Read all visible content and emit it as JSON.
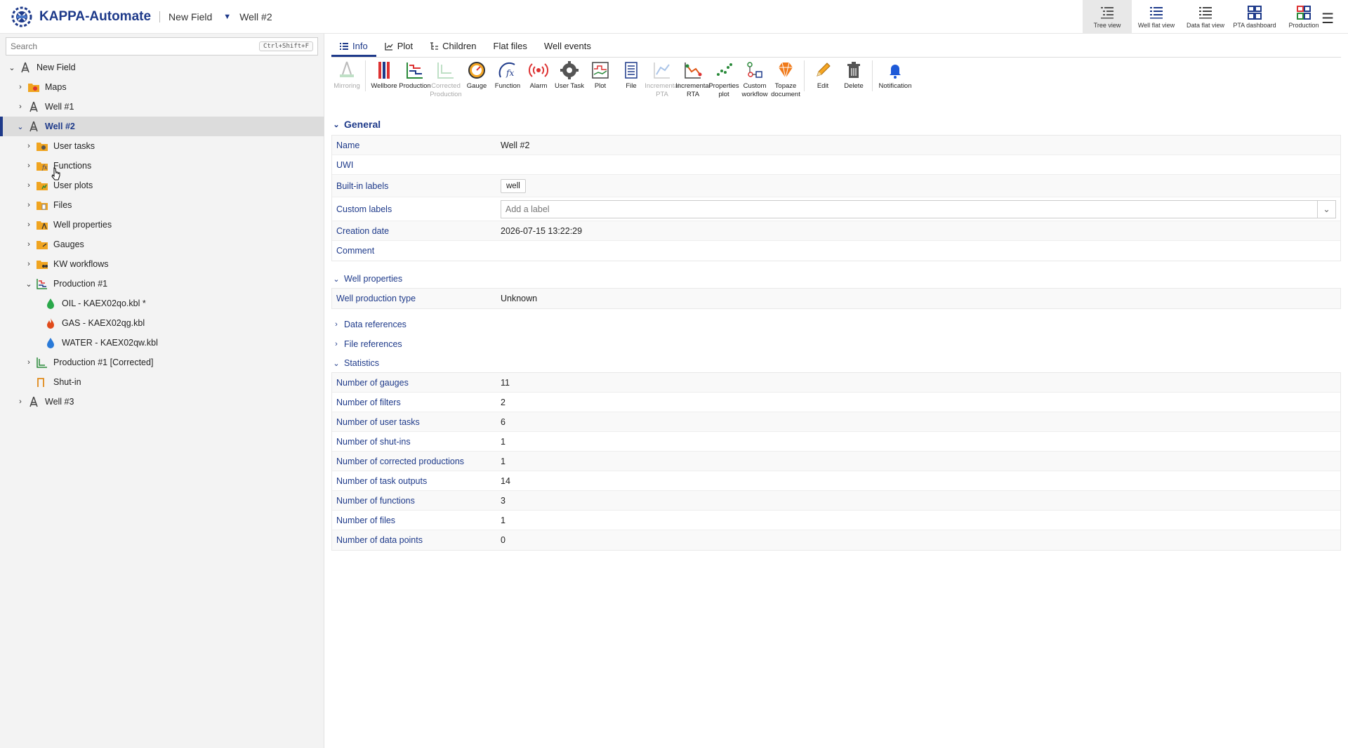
{
  "header": {
    "brand": "KAPPA-Automate",
    "field": "New Field",
    "well": "Well #2",
    "views": [
      {
        "label": "Tree view",
        "icon": "tree-view-icon",
        "active": true
      },
      {
        "label": "Well flat view",
        "icon": "well-flat-view-icon"
      },
      {
        "label": "Data flat view",
        "icon": "data-flat-view-icon"
      },
      {
        "label": "PTA dashboard",
        "icon": "pta-dashboard-icon"
      },
      {
        "label": "Production",
        "icon": "production-dashboard-icon"
      }
    ]
  },
  "sidebar": {
    "search_placeholder": "Search",
    "search_shortcut": "Ctrl+Shift+F",
    "tree": [
      {
        "label": "New Field",
        "icon": "field-icon",
        "expanded": true
      },
      {
        "label": "Maps",
        "icon": "maps-folder-icon"
      },
      {
        "label": "Well #1",
        "icon": "well-icon"
      },
      {
        "label": "Well #2",
        "icon": "well-icon",
        "expanded": true,
        "selected": true
      },
      {
        "label": "User tasks",
        "icon": "user-tasks-folder-icon"
      },
      {
        "label": "Functions",
        "icon": "functions-folder-icon"
      },
      {
        "label": "User plots",
        "icon": "user-plots-folder-icon"
      },
      {
        "label": "Files",
        "icon": "files-folder-icon"
      },
      {
        "label": "Well properties",
        "icon": "well-properties-folder-icon"
      },
      {
        "label": "Gauges",
        "icon": "gauges-folder-icon"
      },
      {
        "label": "KW workflows",
        "icon": "kw-workflows-folder-icon"
      },
      {
        "label": "Production #1",
        "icon": "production-icon",
        "expanded": true
      },
      {
        "label": "OIL - KAEX02qo.kbl *",
        "icon": "oil-drop-icon"
      },
      {
        "label": "GAS - KAEX02qg.kbl",
        "icon": "gas-flame-icon"
      },
      {
        "label": "WATER - KAEX02qw.kbl",
        "icon": "water-drop-icon"
      },
      {
        "label": "Production #1 [Corrected]",
        "icon": "corrected-production-icon"
      },
      {
        "label": "Shut-in",
        "icon": "shut-in-icon"
      },
      {
        "label": "Well #3",
        "icon": "well-icon"
      }
    ]
  },
  "tabs": [
    "Info",
    "Plot",
    "Children",
    "Flat files",
    "Well events"
  ],
  "toolbar": [
    {
      "label": "Mirroring",
      "disabled": true
    },
    {
      "label": "Wellbore"
    },
    {
      "label": "Production"
    },
    {
      "label": "Corrected Production",
      "disabled": true
    },
    {
      "label": "Gauge"
    },
    {
      "label": "Function"
    },
    {
      "label": "Alarm"
    },
    {
      "label": "User Task"
    },
    {
      "label": "Plot"
    },
    {
      "label": "File"
    },
    {
      "label": "Incremental PTA",
      "disabled": true
    },
    {
      "label": "Incremental RTA"
    },
    {
      "label": "Properties plot"
    },
    {
      "label": "Custom workflow"
    },
    {
      "label": "Topaze document"
    },
    {
      "label": "Edit"
    },
    {
      "label": "Delete"
    },
    {
      "label": "Notification"
    }
  ],
  "general": {
    "title": "General",
    "name_label": "Name",
    "name_value": "Well #2",
    "uwi_label": "UWI",
    "builtin_label": "Built-in labels",
    "builtin_value": "well",
    "custom_label": "Custom labels",
    "custom_placeholder": "Add a label",
    "creation_label": "Creation date",
    "creation_value": "2026-07-15 13:22:29",
    "comment_label": "Comment"
  },
  "well_properties": {
    "title": "Well properties",
    "type_label": "Well production type",
    "type_value": "Unknown"
  },
  "data_references": {
    "title": "Data references"
  },
  "file_references": {
    "title": "File references"
  },
  "statistics": {
    "title": "Statistics",
    "rows": [
      {
        "label": "Number of gauges",
        "value": "11"
      },
      {
        "label": "Number of filters",
        "value": "2"
      },
      {
        "label": "Number of user tasks",
        "value": "6"
      },
      {
        "label": "Number of shut-ins",
        "value": "1"
      },
      {
        "label": "Number of corrected productions",
        "value": "1"
      },
      {
        "label": "Number of task outputs",
        "value": "14"
      },
      {
        "label": "Number of functions",
        "value": "3"
      },
      {
        "label": "Number of files",
        "value": "1"
      },
      {
        "label": "Number of data points",
        "value": "0"
      }
    ]
  },
  "colors": {
    "accent": "#1e3a8a",
    "folder": "#f0a41f"
  }
}
